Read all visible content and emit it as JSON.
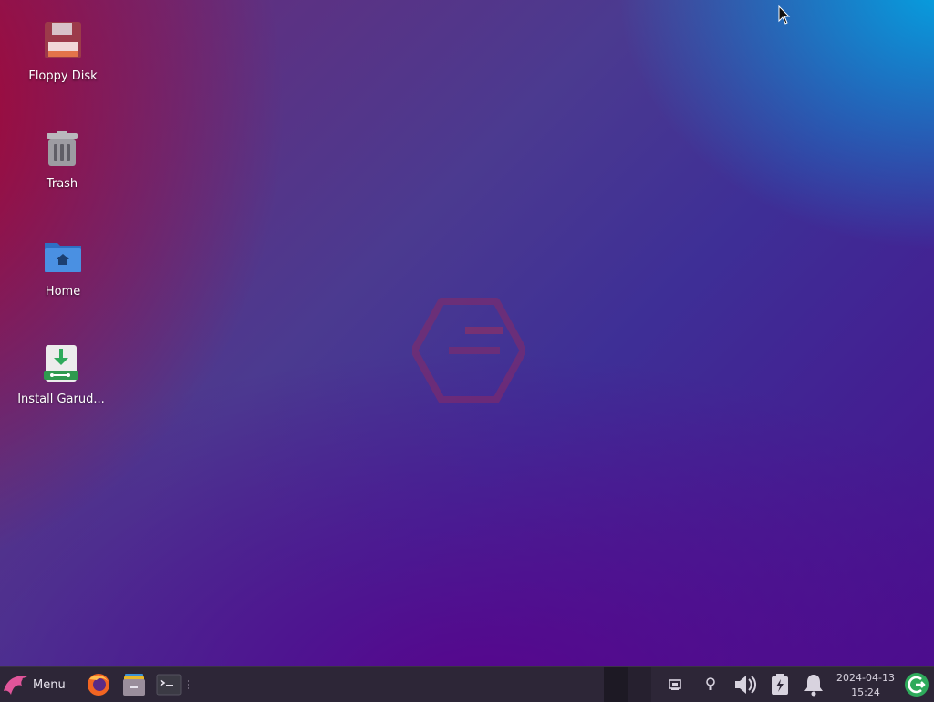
{
  "desktop": {
    "icons": [
      {
        "label": "Floppy Disk",
        "icon": "floppy-disk-icon"
      },
      {
        "label": "Trash",
        "icon": "trash-icon"
      },
      {
        "label": "Home",
        "icon": "home-folder-icon"
      },
      {
        "label": "Install Garud...",
        "icon": "installer-icon"
      }
    ],
    "watermark": "garuda-logo"
  },
  "taskbar": {
    "menu_label": "Menu",
    "launchers": [
      "firefox-icon",
      "file-manager-icon",
      "terminal-icon"
    ],
    "tray": [
      "network-icon",
      "lightbulb-icon",
      "volume-icon",
      "battery-charging-icon",
      "notification-bell-icon"
    ],
    "date": "2024-04-13",
    "time": "15:24",
    "colors": {
      "panel": "#2d2637",
      "accent": "#2eaa5b"
    }
  }
}
